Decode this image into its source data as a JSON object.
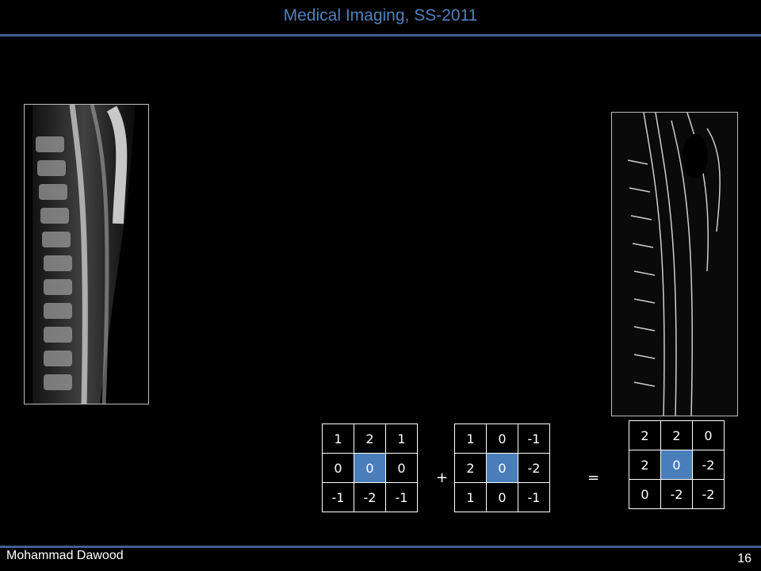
{
  "slide": {
    "title": "Medical Imaging, SS-2011",
    "author": "Mohammad Dawood",
    "page_number": "16"
  },
  "images": {
    "original": "spine-mri-original",
    "result": "spine-mri-edge-filtered"
  },
  "equation": {
    "plus": "+",
    "equals": "=",
    "matrix_a": [
      [
        "1",
        "2",
        "1"
      ],
      [
        "0",
        "0",
        "0"
      ],
      [
        "-1",
        "-2",
        "-1"
      ]
    ],
    "matrix_b": [
      [
        "1",
        "0",
        "-1"
      ],
      [
        "2",
        "0",
        "-2"
      ],
      [
        "1",
        "0",
        "-1"
      ]
    ],
    "matrix_c": [
      [
        "2",
        "2",
        "0"
      ],
      [
        "2",
        "0",
        "-2"
      ],
      [
        "0",
        "-2",
        "-2"
      ]
    ]
  },
  "colors": {
    "accent": "#4f81bd",
    "center_cell": "#4a7ebb",
    "rule": "#3f5f92"
  }
}
